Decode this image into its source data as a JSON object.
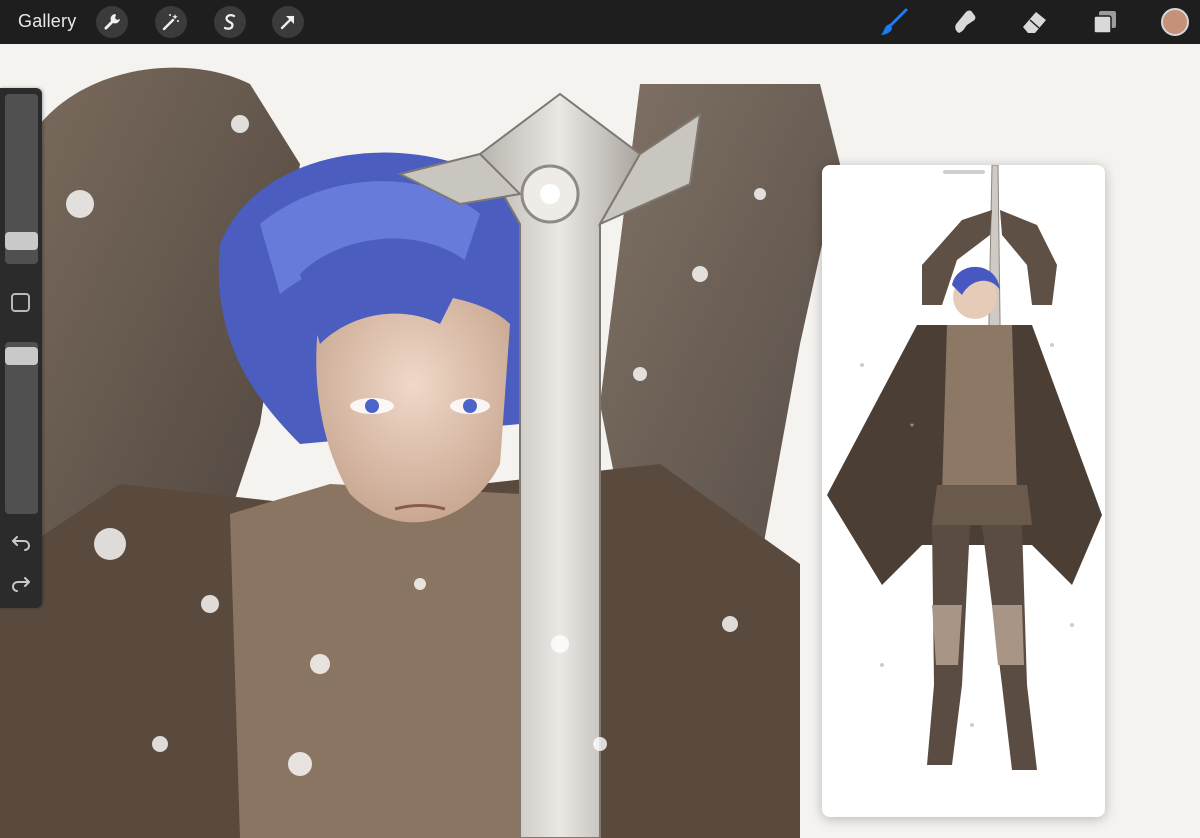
{
  "app": {
    "gallery_label": "Gallery"
  },
  "toolbar": {
    "left_tools": [
      {
        "icon": "wrench-icon",
        "name": "actions"
      },
      {
        "icon": "magic-wand-icon",
        "name": "adjustments"
      },
      {
        "icon": "selection-s-icon",
        "name": "selection"
      },
      {
        "icon": "arrow-cursor-icon",
        "name": "transform"
      }
    ],
    "right_tools": [
      {
        "icon": "brush-icon",
        "name": "paint",
        "active": true
      },
      {
        "icon": "smudge-icon",
        "name": "smudge"
      },
      {
        "icon": "eraser-icon",
        "name": "eraser"
      },
      {
        "icon": "layers-icon",
        "name": "layers"
      }
    ],
    "current_color": "#c4917a",
    "accent_color": "#1a7bf2"
  },
  "sidebar": {
    "brush_size_level": 0.09,
    "opacity_level": 0.97,
    "undo_icon": "undo-icon",
    "redo_icon": "redo-icon"
  },
  "reference": {
    "visible": true
  }
}
